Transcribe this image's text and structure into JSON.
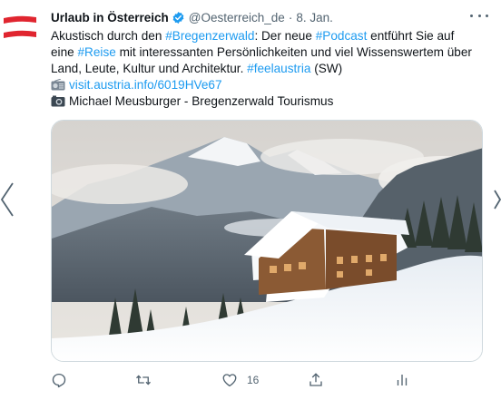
{
  "tweet": {
    "author_name": "Urlaub in Österreich",
    "handle": "@Oesterreich_de",
    "separator": "·",
    "date": "8. Jan.",
    "lines": {
      "l1_a": "Akustisch durch den ",
      "l1_tag1": "#Bregenzerwald",
      "l1_b": ": Der neue ",
      "l1_tag2": "#Podcast",
      "l1_c": " entführt Sie auf",
      "l2_a": "eine ",
      "l2_tag": "#Reise",
      "l2_b": " mit interessanten Persönlichkeiten und viel Wissenswertem über",
      "l3_a": "Land, Leute, Kultur und Architektur. ",
      "l3_tag": "#feelaustria",
      "l3_b": " (SW)",
      "l4_link": "visit.austria.info/6019HVe67",
      "l5_credit": "Michael Meusburger - Bregenzerwald Tourismus"
    },
    "actions": {
      "reply_count": "",
      "retweet_count": "",
      "like_count": "16"
    }
  },
  "icons": {
    "avatar": "austria-flag-logo",
    "verified": "verified-badge-icon",
    "more": "more-options-icon",
    "link_emoji": "radio-icon",
    "credit_emoji": "camera-icon",
    "reply": "reply-icon",
    "retweet": "retweet-icon",
    "like": "heart-icon",
    "share": "share-icon",
    "analytics": "analytics-icon"
  },
  "colors": {
    "accent": "#1d9bf0",
    "flag_red": "#e0252f",
    "muted": "#536471"
  }
}
